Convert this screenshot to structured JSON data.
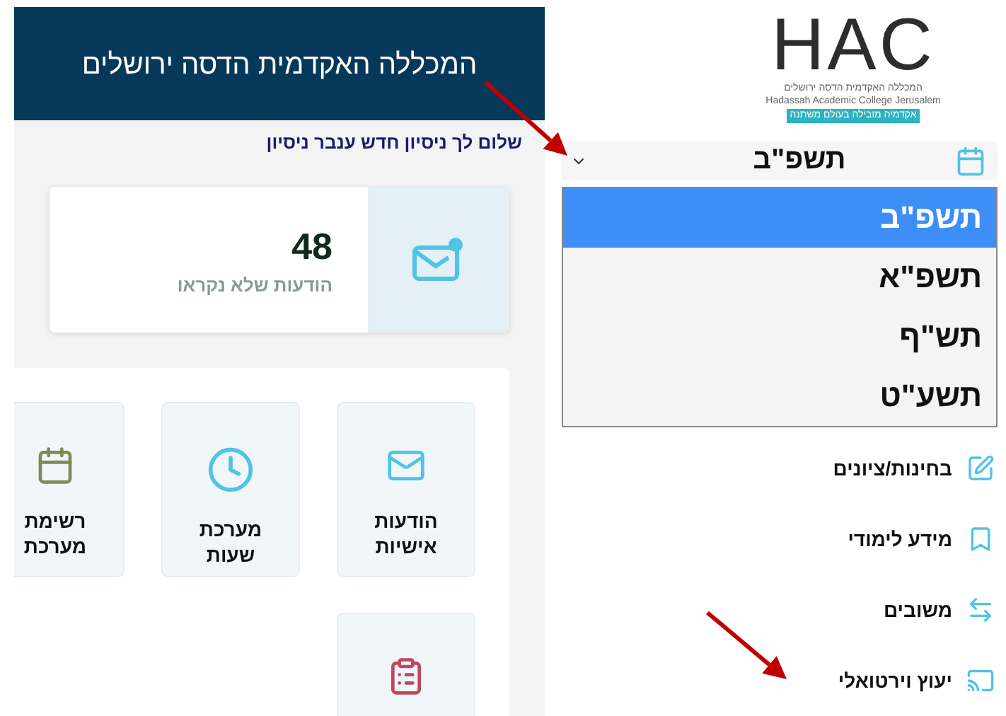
{
  "logo": {
    "wordmark": "HAC",
    "name_hebrew": "המכללה האקדמית הדסה ירושלים",
    "name_english": "Hadassah Academic College Jerusalem",
    "tagline": "אקדמיה מובילה בעולם משתנה"
  },
  "year_select": {
    "value": "תשפ\"ב",
    "options": [
      {
        "label": "תשפ\"ב",
        "selected": true
      },
      {
        "label": "תשפ\"א",
        "selected": false
      },
      {
        "label": "תש\"ף",
        "selected": false
      },
      {
        "label": "תשע\"ט",
        "selected": false
      }
    ]
  },
  "sidebar": {
    "items": [
      {
        "label": "בחינות/ציונים",
        "kind": "edit"
      },
      {
        "label": "מידע לימודי",
        "kind": "bookmark"
      },
      {
        "label": "משובים",
        "kind": "swap"
      },
      {
        "label": "יעוץ וירטואלי",
        "kind": "cast"
      }
    ]
  },
  "header": {
    "title": "המכללה האקדמית הדסה ירושלים"
  },
  "greeting": "שלום לך ניסיון חדש ענבר ניסיון",
  "unread_card": {
    "count": "48",
    "label": "הודעות שלא נקראו"
  },
  "tiles": [
    {
      "label": "הודעות אישיות",
      "kind": "mail",
      "color": "#4fc3e8"
    },
    {
      "label": "מערכת שעות",
      "kind": "clock",
      "color": "#4fc3e8"
    },
    {
      "label": "רשימת מערכת",
      "kind": "calendar",
      "color": "#7f8a55"
    },
    {
      "kind": "clipboard",
      "color": "#c0475f"
    }
  ]
}
